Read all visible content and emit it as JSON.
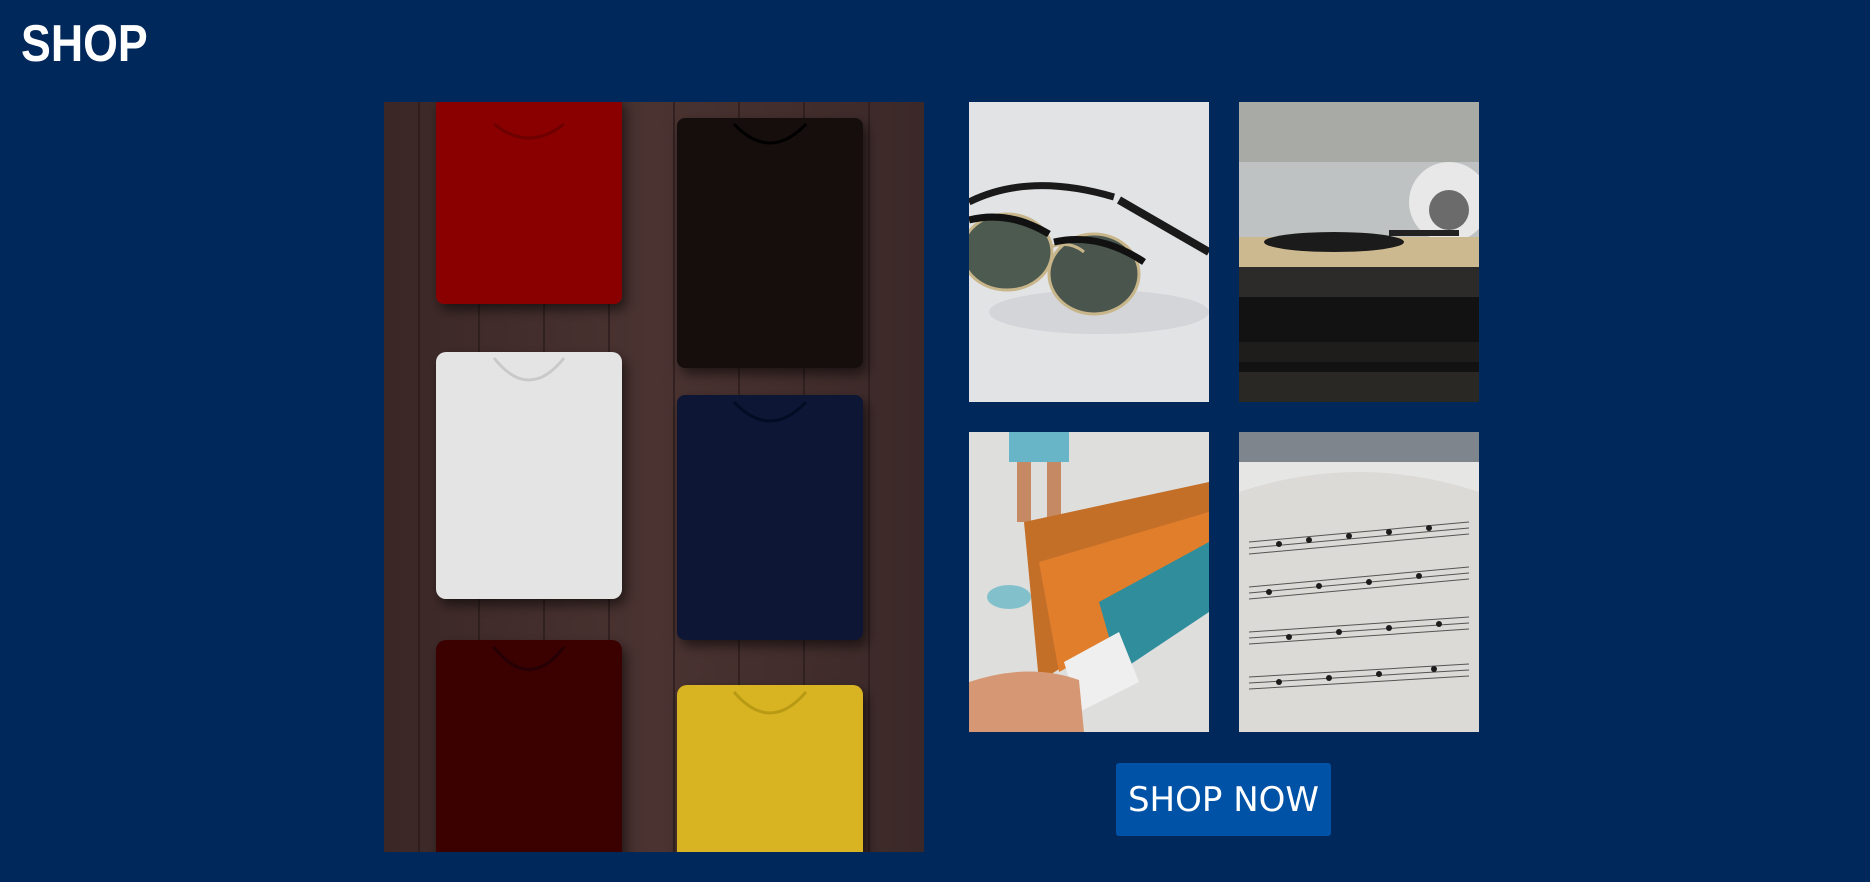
{
  "header": {
    "title": "SHOP"
  },
  "gallery": {
    "images": [
      {
        "name": "folded-tshirts-photo"
      },
      {
        "name": "sunglasses-photo"
      },
      {
        "name": "record-turntable-photo"
      },
      {
        "name": "concert-tickets-photo"
      },
      {
        "name": "sheet-music-photo"
      }
    ]
  },
  "cta": {
    "label": "SHOP NOW"
  },
  "colors": {
    "background": "#00285a",
    "button": "#0052a6",
    "text": "#ffffff"
  }
}
